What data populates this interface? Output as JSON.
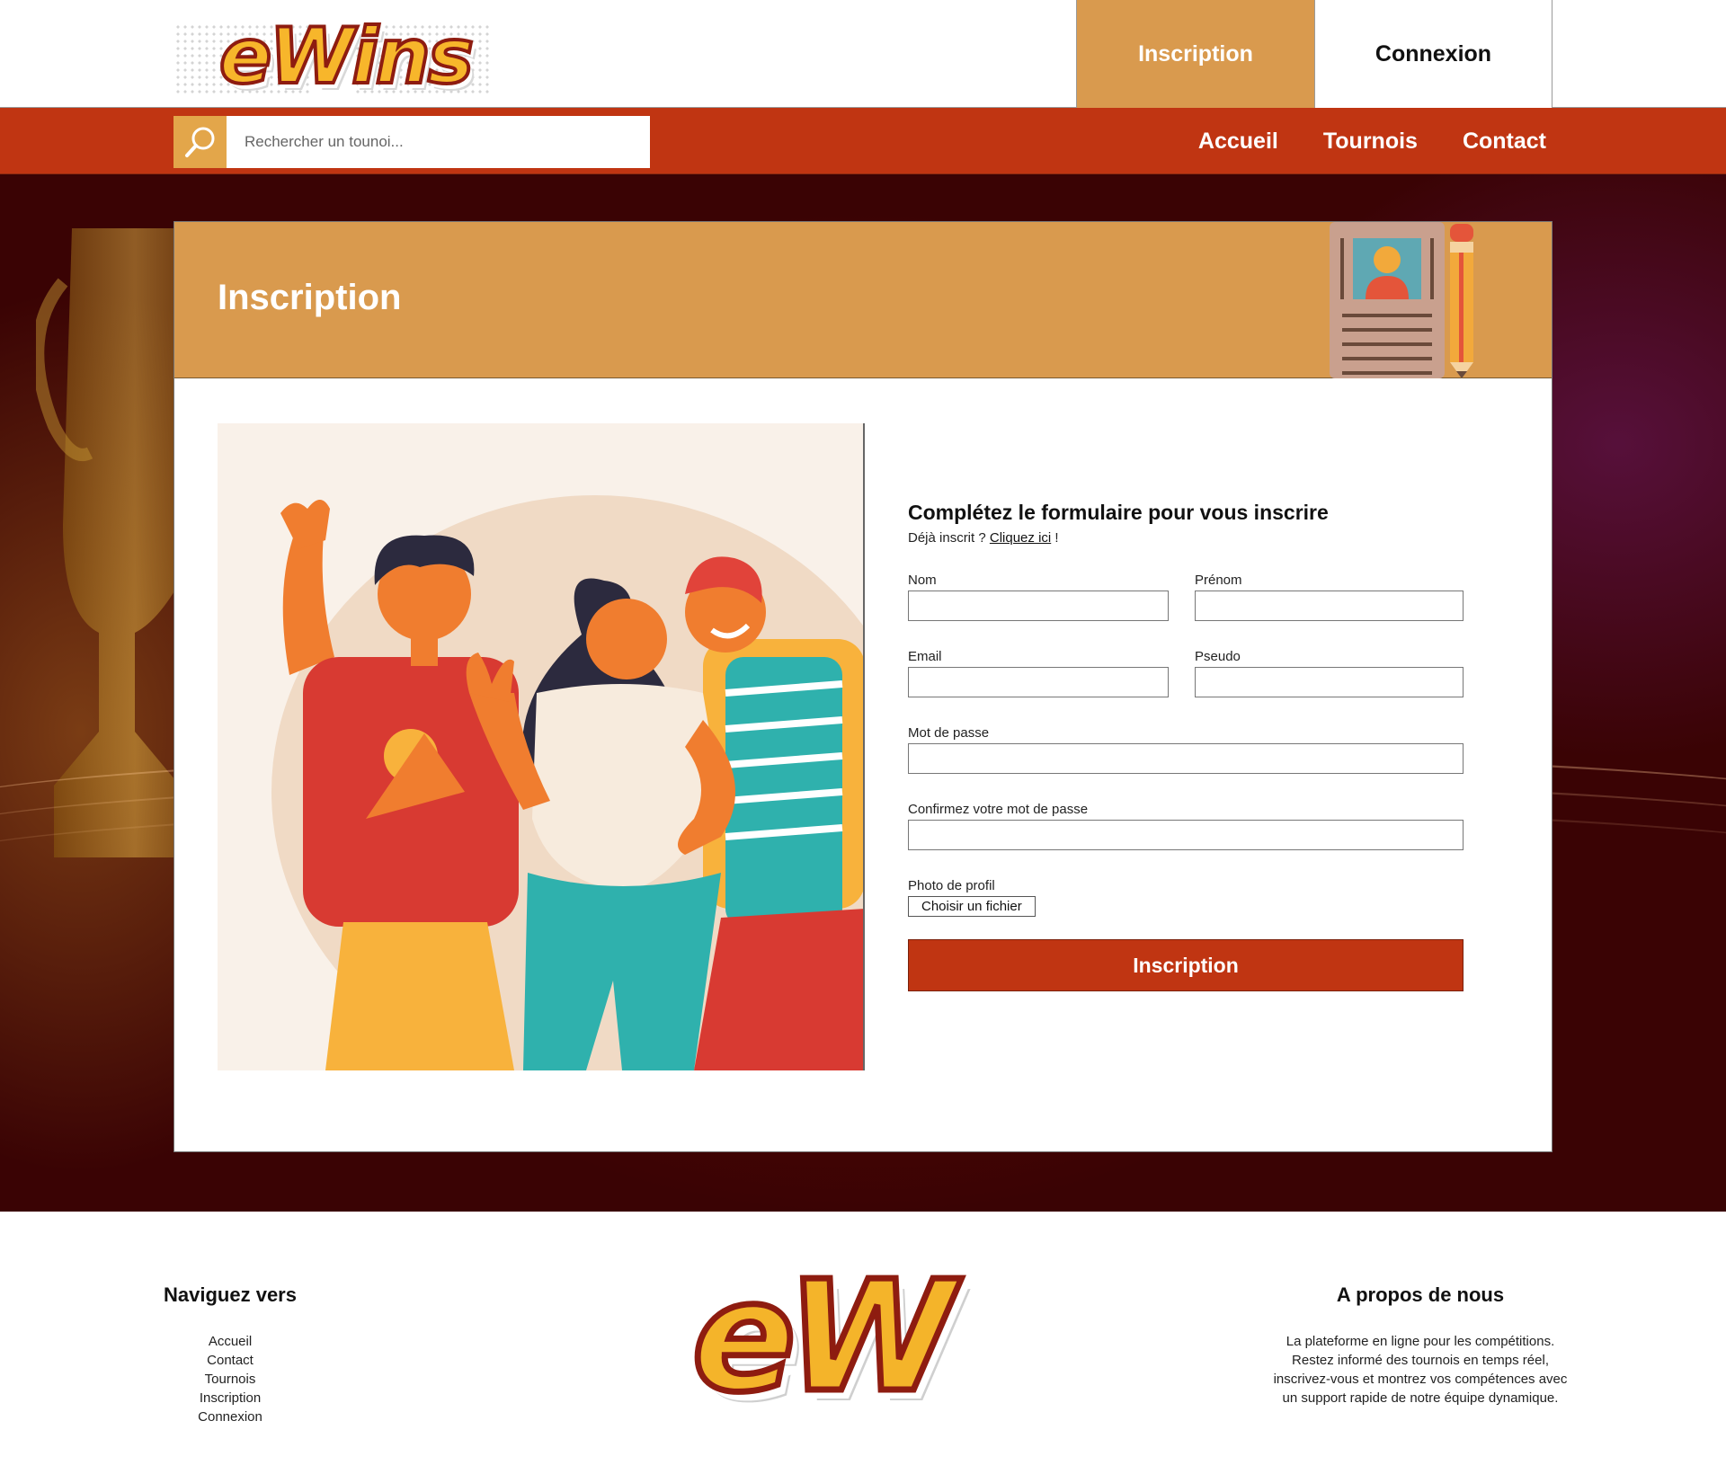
{
  "brand": {
    "logo_text": "eWins",
    "footer_logo_text": "eW"
  },
  "auth": {
    "inscription_label": "Inscription",
    "connexion_label": "Connexion"
  },
  "search": {
    "placeholder": "Rechercher un tounoi..."
  },
  "nav": {
    "items": [
      "Accueil",
      "Tournois",
      "Contact"
    ]
  },
  "page": {
    "title": "Inscription"
  },
  "form": {
    "title": "Complétez le formulaire pour vous inscrire",
    "already_text": "Déjà inscrit ? ",
    "link_text": "Cliquez ici",
    "after_link": " !",
    "fields": {
      "nom": "Nom",
      "prenom": "Prénom",
      "email": "Email",
      "pseudo": "Pseudo",
      "password": "Mot de passe",
      "confirm_password": "Confirmez votre mot de passe",
      "photo": "Photo de profil"
    },
    "file_button": "Choisir un fichier",
    "submit_label": "Inscription"
  },
  "footer": {
    "nav_title": "Naviguez vers",
    "nav_links": [
      "Accueil",
      "Contact",
      "Tournois",
      "Inscription",
      "Connexion"
    ],
    "about_title": "A propos de nous",
    "about_lines": [
      "La plateforme en ligne pour les compétitions.",
      "Restez informé des tournois en temps réel,",
      "inscrivez-vous et montrez vos compétences avec",
      "un support rapide de notre équipe dynamique."
    ]
  },
  "colors": {
    "accent_orange": "#d99a4e",
    "brand_red": "#c03512",
    "search_button": "#e3a64a"
  }
}
